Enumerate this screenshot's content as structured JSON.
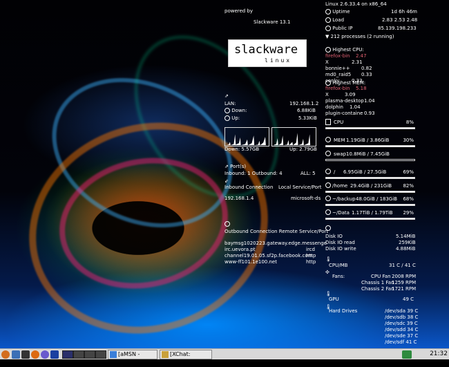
{
  "left": {
    "powered_by": "powered by",
    "distro": "Slackware 13.1",
    "logo": {
      "big": "slackware",
      "small": "linux"
    },
    "lan_label": "LAN:",
    "lan_ip": "192.168.1.2",
    "down_label": "Down:",
    "down_rate": "6.88KiB",
    "up_label": "Up:",
    "up_rate": "5.33KiB",
    "down_total": "Down: 5.57GB",
    "up_total": "Up: 2.79GB",
    "ports_label": "Port(s)",
    "inbound_outbound": "Inbound: 1 Outbound: 4",
    "all_ports": "ALL: 5",
    "inbound_header": "Inbound Connection",
    "local_service_header": "Local Service/Port",
    "inbound_ip": "192.168.1.4",
    "inbound_service": "microsoft-ds",
    "outbound_header": "Outbound Connection Remote Service/Port",
    "outbound": [
      {
        "host": "baymsg1020223.gateway.edge.messenge",
        "port": ""
      },
      {
        "host": "irc.uevora.pt",
        "port": "ircd"
      },
      {
        "host": "channel19.01.05.sf2p.facebook.com",
        "port": "http"
      },
      {
        "host": "www-ff101.1e100.net",
        "port": "http"
      }
    ]
  },
  "right": {
    "kernel": "Linux 2.6.33.4 on x86_64",
    "uptime_label": "Uptime",
    "uptime": "1d 6h 46m",
    "load_label": "Load",
    "load": "2.83 2.53 2.48",
    "public_ip_label": "Public IP",
    "public_ip": "85.139.198.233",
    "processes": "212 processes (2 running)",
    "cpu_top_label": "Highest CPU:",
    "cpu_top": [
      {
        "name": "firefox-bin",
        "value": "2.47",
        "hot": true
      },
      {
        "name": "X",
        "value": "2.31",
        "hot": false
      },
      {
        "name": "bonnie++",
        "value": "0.82",
        "hot": false
      },
      {
        "name": "md0_raid5",
        "value": "0.33",
        "hot": false
      },
      {
        "name": "conky",
        "value": "0.33",
        "hot": false
      }
    ],
    "mem_top_label": "Highest MEM:",
    "mem_top": [
      {
        "name": "firefox-bin",
        "value": "5.18",
        "hot": true
      },
      {
        "name": "X",
        "value": "3.09",
        "hot": false
      },
      {
        "name": "plasma-desktop",
        "value": "1.04",
        "hot": false
      },
      {
        "name": "dolphin",
        "value": "1.04",
        "hot": false
      },
      {
        "name": "plugin-containe",
        "value": "0.93",
        "hot": false
      }
    ],
    "meters": [
      {
        "icon": "cpu-icon",
        "label": "CPU",
        "detail": "",
        "percent_text": "8%",
        "fraction": 0.08
      },
      {
        "icon": "memory-icon",
        "label": "MEM",
        "detail": "1.19GiB / 3.86GiB",
        "percent_text": "30%",
        "fraction": 0.3
      },
      {
        "icon": "swap-icon",
        "label": "swap",
        "detail": "10.8MiB / 7.45GiB",
        "percent_text": "0%",
        "fraction": 0.0
      },
      {
        "icon": "disk-root-icon",
        "label": "/",
        "detail": "6.95GiB / 27.5GiB",
        "percent_text": "69%",
        "fraction": 0.69
      },
      {
        "icon": "disk-home-icon",
        "label": "/home",
        "detail": "29.4GiB / 231GiB",
        "percent_text": "82%",
        "fraction": 0.82
      },
      {
        "icon": "disk-backup-icon",
        "label": "~/backup",
        "detail": "48.0GiB / 183GiB",
        "percent_text": "68%",
        "fraction": 0.68
      },
      {
        "icon": "disk-data-icon",
        "label": "~/Data",
        "detail": "1.17TiB / 1.79TiB",
        "percent_text": "29%",
        "fraction": 0.29
      }
    ],
    "disk_io_label": "Disk IO",
    "disk_io": "5.14MiB",
    "disk_read_label": "Disk IO read",
    "disk_read": "259KiB",
    "disk_write_label": "Disk IO write",
    "disk_write": "4.88MiB",
    "cpu_mb_label": "CPU/MB",
    "cpu_mb": "31 C / 41 C",
    "fans_label": "Fans:",
    "fans": [
      {
        "name": "CPU Fan",
        "rpm": "2008 RPM"
      },
      {
        "name": "Chassis 1 Fan",
        "rpm": "1259 RPM"
      },
      {
        "name": "Chassis 2 Fan",
        "rpm": "1721 RPM"
      }
    ],
    "gpu_label": "GPU",
    "gpu": "49 C",
    "hdd_label": "Hard Drives",
    "drives": [
      "/dev/sda 39 C",
      "/dev/sdb 38 C",
      "/dev/sdc 39 C",
      "/dev/sdd 34 C",
      "/dev/sde 37 C",
      "/dev/sdf 41 C"
    ]
  },
  "taskbar": {
    "tasks": [
      "[aMSN - Offline]",
      "[XChat: Alt_of_..."
    ],
    "clock": "21:32"
  }
}
